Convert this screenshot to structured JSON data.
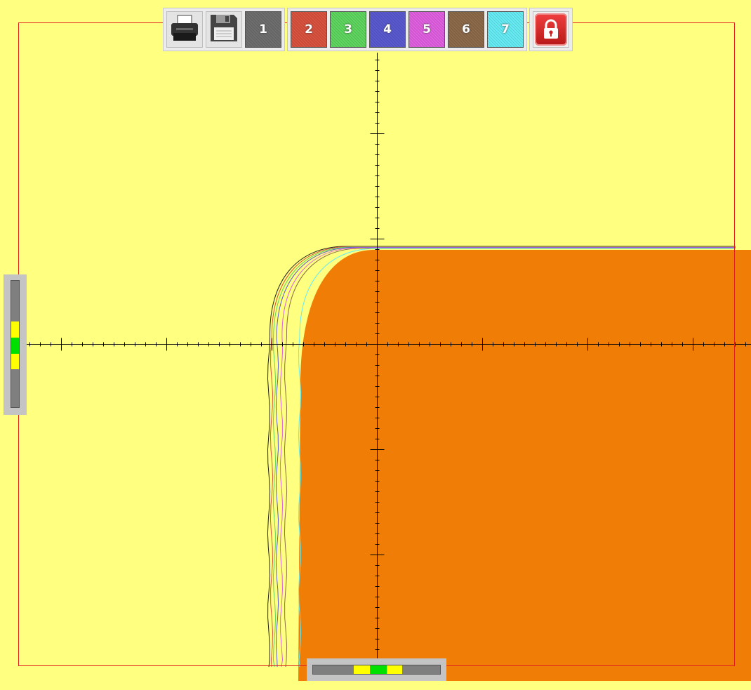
{
  "toolbar": {
    "file_buttons": [
      {
        "icon": "printer-icon"
      },
      {
        "icon": "floppy-disk-icon"
      }
    ],
    "layer_buttons": [
      {
        "label": "1",
        "color": "#6e6e6e"
      },
      {
        "label": "2",
        "color": "#d9533f"
      },
      {
        "label": "3",
        "color": "#5fd65f"
      },
      {
        "label": "4",
        "color": "#5a5ad0"
      },
      {
        "label": "5",
        "color": "#e060e0"
      },
      {
        "label": "6",
        "color": "#8c6a4a"
      },
      {
        "label": "7",
        "color": "#66ecf4"
      }
    ],
    "lock_button": {
      "icon": "lock-icon",
      "color": "#d32020"
    }
  },
  "canvas": {
    "background_color": "#ffff80",
    "frame_color": "#e02020",
    "filled_region_color": "#f07d06"
  },
  "vertical_slider": {
    "segments": [
      {
        "color": "#7f7f7f"
      },
      {
        "color": "#ffff00"
      },
      {
        "color": "#00e000"
      },
      {
        "color": "#ffff00"
      },
      {
        "color": "#7f7f7f"
      }
    ]
  },
  "horizontal_slider": {
    "segments": [
      {
        "color": "#7f7f7f"
      },
      {
        "color": "#ffff00"
      },
      {
        "color": "#00e000"
      },
      {
        "color": "#ffff00"
      },
      {
        "color": "#7f7f7f"
      }
    ]
  }
}
